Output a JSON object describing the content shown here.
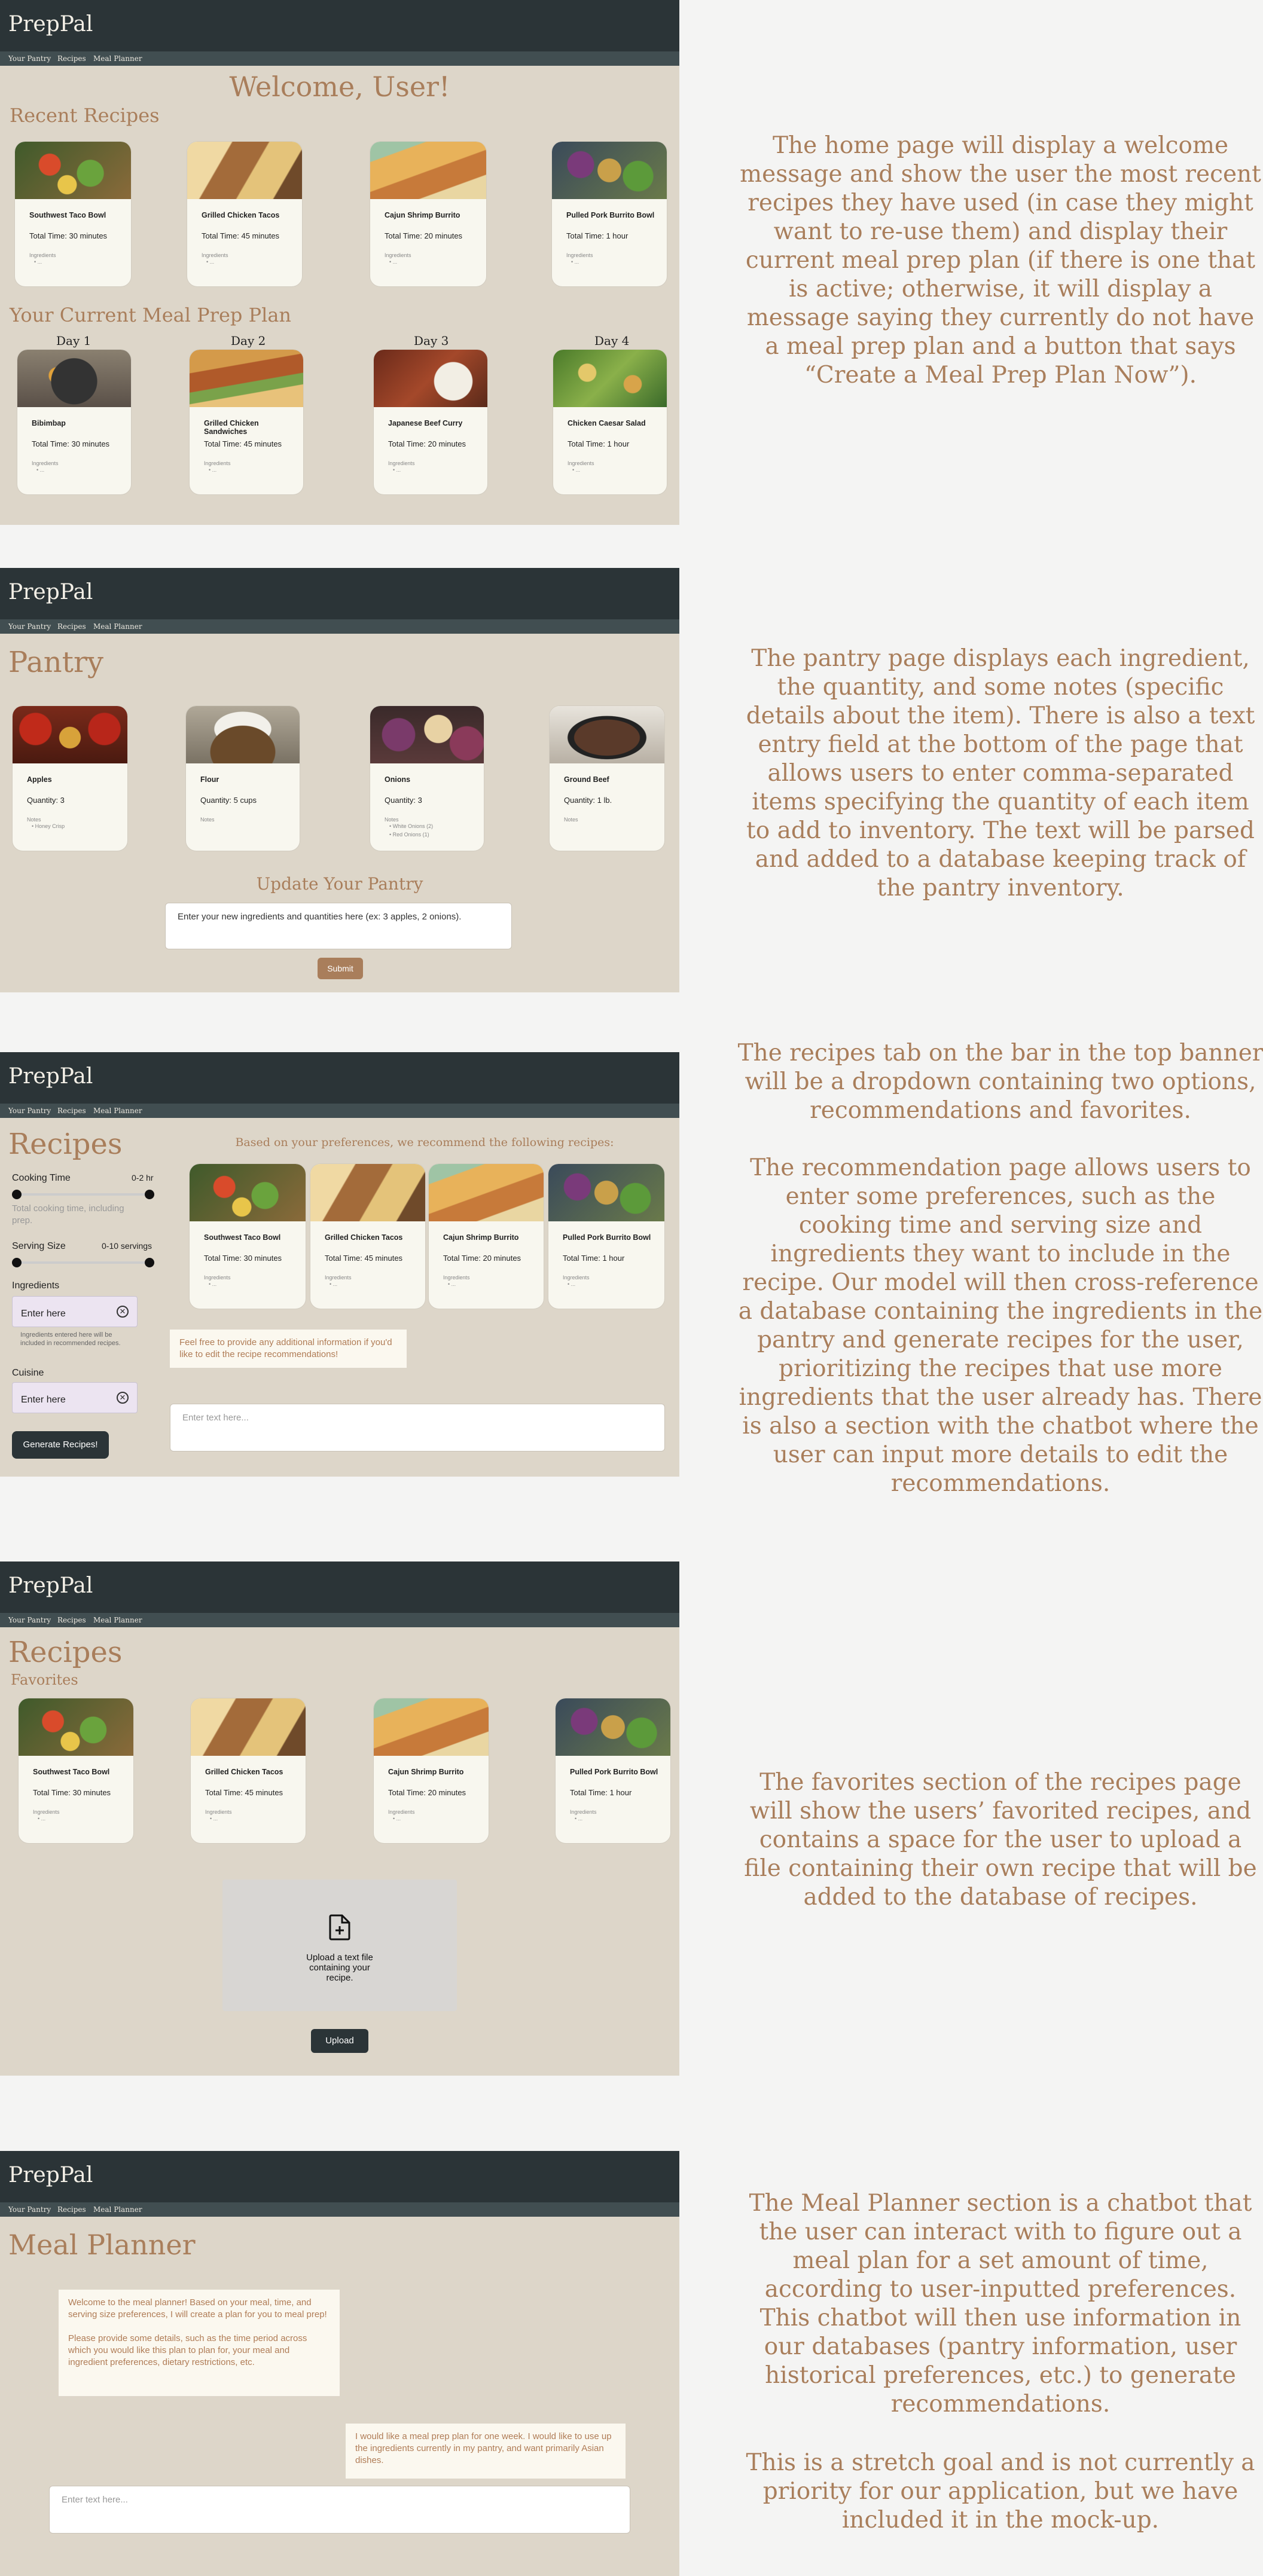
{
  "app": {
    "logo": "PrepPal",
    "nav": [
      "Your Pantry",
      "Recipes",
      "Meal Planner"
    ]
  },
  "colors": {
    "header": "#2b3437",
    "nav": "#414e51",
    "panel": "#ddd6c9",
    "accent": "#a97e5b",
    "card": "#f8f7ef"
  },
  "common": {
    "ingredients_label": "Ingredients",
    "placeholder_dot": "• ..."
  },
  "home": {
    "welcome": "Welcome, User!",
    "recent_title": "Recent Recipes",
    "recent": [
      {
        "name": "Southwest Taco Bowl",
        "time": "Total Time: 30 minutes"
      },
      {
        "name": "Grilled Chicken Tacos",
        "time": "Total Time: 45 minutes"
      },
      {
        "name": "Cajun Shrimp Burrito",
        "time": "Total Time: 20 minutes"
      },
      {
        "name": "Pulled Pork Burrito Bowl",
        "time": "Total Time: 1 hour"
      }
    ],
    "plan_title": "Your Current Meal Prep Plan",
    "plan": [
      {
        "day": "Day 1",
        "name": "Bibimbap",
        "time": "Total Time: 30 minutes"
      },
      {
        "day": "Day 2",
        "name": "Grilled Chicken Sandwiches",
        "time": "Total Time: 45 minutes"
      },
      {
        "day": "Day 3",
        "name": "Japanese Beef Curry",
        "time": "Total Time: 20 minutes"
      },
      {
        "day": "Day 4",
        "name": "Chicken Caesar Salad",
        "time": "Total Time: 1 hour"
      }
    ],
    "description": "The home page will display a welcome message and show the user the most recent recipes they have used (in case they might want to re-use them) and display their current meal prep plan (if there is one that is active; otherwise, it will display a message saying they currently do not have a meal prep plan and a button that says “Create a Meal Prep Plan Now”)."
  },
  "pantry": {
    "title": "Pantry",
    "items": [
      {
        "name": "Apples",
        "qty": "Quantity: 3",
        "notes_label": "Notes",
        "notes": [
          "Honey Crisp"
        ]
      },
      {
        "name": "Flour",
        "qty": "Quantity: 5 cups",
        "notes_label": "Notes",
        "notes": []
      },
      {
        "name": "Onions",
        "qty": "Quantity: 3",
        "notes_label": "Notes",
        "notes": [
          "White Onions (2)",
          "Red Onions (1)"
        ]
      },
      {
        "name": "Ground Beef",
        "qty": "Quantity: 1 lb.",
        "notes_label": "Notes",
        "notes": []
      }
    ],
    "update_title": "Update Your Pantry",
    "input_placeholder": "Enter your new ingredients and quantities here (ex: 3 apples, 2 onions).",
    "submit": "Submit",
    "description": "The pantry page displays each ingredient, the quantity, and some notes (specific details about the item). There is also a text entry field at the bottom of the page that allows users to enter comma-separated items specifying the quantity of each item to add to inventory. The text will be parsed and added to a database keeping track of the pantry inventory."
  },
  "recommend": {
    "title": "Recipes",
    "cooking_time_label": "Cooking Time",
    "cooking_time_range": "0-2 hr",
    "cooking_time_help": "Total cooking time, including prep.",
    "serving_label": "Serving Size",
    "serving_range": "0-10 servings",
    "ingredients_label": "Ingredients",
    "enter_here": "Enter here",
    "ingredients_help": "Ingredients entered here will be included in recommended recipes.",
    "cuisine_label": "Cuisine",
    "generate": "Generate Recipes!",
    "heading": "Based on your preferences, we recommend the following recipes:",
    "recipes": [
      {
        "name": "Southwest Taco Bowl",
        "time": "Total Time: 30 minutes"
      },
      {
        "name": "Grilled Chicken Tacos",
        "time": "Total Time: 45 minutes"
      },
      {
        "name": "Cajun Shrimp Burrito",
        "time": "Total Time: 20 minutes"
      },
      {
        "name": "Pulled Pork Burrito Bowl",
        "time": "Total Time: 1 hour"
      }
    ],
    "bot_msg": "Feel free to provide any additional information if you'd like to edit the recipe recommendations!",
    "chat_placeholder": "Enter text here...",
    "description1": "The recipes tab on the bar in the top banner will be a dropdown containing two options, recommendations and favorites.",
    "description2": "The recommendation page allows users to enter some preferences, such as the cooking time and serving size and ingredients they want to include in the recipe. Our model will then cross-reference a database containing the ingredients in the pantry and generate recipes for the user, prioritizing the recipes that use more ingredients that the user already has. There is also a section with the chatbot where the user can input more details to edit the recommendations."
  },
  "favorites": {
    "title": "Recipes",
    "subtitle": "Favorites",
    "recipes": [
      {
        "name": "Southwest Taco Bowl",
        "time": "Total Time: 30 minutes"
      },
      {
        "name": "Grilled Chicken Tacos",
        "time": "Total Time: 45 minutes"
      },
      {
        "name": "Cajun Shrimp Burrito",
        "time": "Total Time: 20 minutes"
      },
      {
        "name": "Pulled Pork Burrito Bowl",
        "time": "Total Time: 1 hour"
      }
    ],
    "upload_text": "Upload a text file containing your recipe.",
    "upload_button": "Upload",
    "description": "The favorites section of the recipes page will show the users’ favorited recipes, and contains a space for the user to upload a file containing their own recipe that will be added to the database of recipes."
  },
  "planner": {
    "title": "Meal Planner",
    "bot1a": "Welcome to the meal planner! Based on your meal, time, and serving size preferences, I will create a plan for you to meal prep!",
    "bot1b": "Please provide some details, such as the time period across which you would like this plan to plan for, your meal and ingredient preferences, dietary restrictions, etc.",
    "user1": "I would like a meal prep plan for one week. I would like to use up the ingredients currently in my pantry, and want primarily Asian dishes.",
    "chat_placeholder": "Enter text here...",
    "description1": "The Meal Planner section is a chatbot that the user can interact with to figure out a meal plan for a set amount of time, according to user-inputted preferences. This chatbot will then use information in our databases (pantry information, user historical preferences, etc.) to generate recommendations.",
    "description2": "This is a stretch goal and is not currently a priority for our application, but we have included it in the mock-up."
  }
}
